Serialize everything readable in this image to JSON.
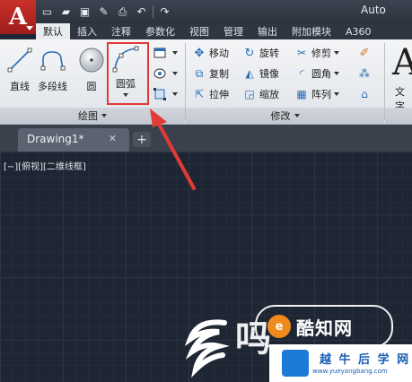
{
  "app": {
    "title": "Auto",
    "logo_letter": "A"
  },
  "quick_access": [
    {
      "icon": "new-file-icon",
      "glyph": "▭"
    },
    {
      "icon": "open-folder-icon",
      "glyph": "▰"
    },
    {
      "icon": "save-icon",
      "glyph": "▣"
    },
    {
      "icon": "save-as-icon",
      "glyph": "✎"
    },
    {
      "icon": "print-icon",
      "glyph": "⎙"
    },
    {
      "icon": "undo-icon",
      "glyph": "↶"
    },
    {
      "icon": "redo-icon",
      "glyph": "↷"
    }
  ],
  "ribbon_tabs": [
    "默认",
    "插入",
    "注释",
    "参数化",
    "视图",
    "管理",
    "输出",
    "附加模块",
    "A360"
  ],
  "active_tab": "默认",
  "draw_panel": {
    "title": "绘图",
    "buttons": [
      "直线",
      "多段线",
      "圆",
      "圆弧"
    ]
  },
  "modify_panel": {
    "title": "修改",
    "rows": [
      [
        "移动",
        "旋转",
        "修剪"
      ],
      [
        "复制",
        "镜像",
        "圆角"
      ],
      [
        "拉伸",
        "缩放",
        "阵列"
      ]
    ]
  },
  "text_button": "文字",
  "text_glyph": "A",
  "document": {
    "tab_name": "Drawing1*",
    "close_glyph": "✕",
    "new_tab_glyph": "+"
  },
  "viewport_label": "[−][俯视][二维线框]",
  "watermarks": {
    "badge1_text": "酷知网",
    "badge1_letter": "e",
    "glyph_char": "吗",
    "site_name": "越 牛 后 学 网",
    "site_url": "www.yueyangbang.com"
  },
  "colors": {
    "accent_red": "#e23b37",
    "logo_red": "#c9302c",
    "ribbon_bg": "#eceff2",
    "canvas_bg": "#1f2633",
    "site_blue": "#1a5fb4"
  }
}
